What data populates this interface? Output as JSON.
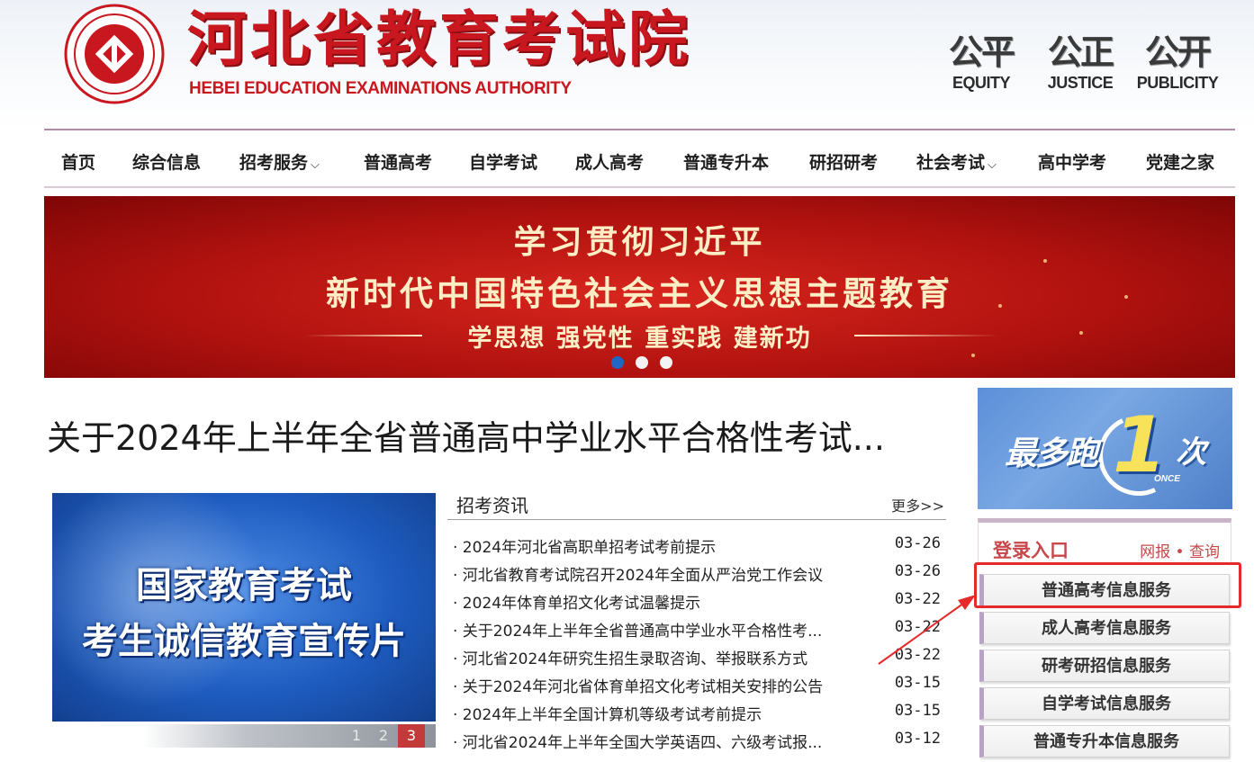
{
  "header": {
    "logo_cn": "河北省教育考试院",
    "logo_en": "HEBEI EDUCATION EXAMINATIONS AUTHORITY",
    "emblem_icon": "authority-emblem-icon",
    "mottos": [
      {
        "cn": "公平",
        "en": "EQUITY"
      },
      {
        "cn": "公正",
        "en": "JUSTICE"
      },
      {
        "cn": "公开",
        "en": "PUBLICITY"
      }
    ]
  },
  "nav": {
    "items": [
      {
        "label": "首页",
        "dropdown": false
      },
      {
        "label": "综合信息",
        "dropdown": false
      },
      {
        "label": "招考服务",
        "dropdown": true
      },
      {
        "label": "普通高考",
        "dropdown": false
      },
      {
        "label": "自学考试",
        "dropdown": false
      },
      {
        "label": "成人高考",
        "dropdown": false
      },
      {
        "label": "普通专升本",
        "dropdown": false
      },
      {
        "label": "研招研考",
        "dropdown": false
      },
      {
        "label": "社会考试",
        "dropdown": true
      },
      {
        "label": "高中学考",
        "dropdown": false
      },
      {
        "label": "党建之家",
        "dropdown": false
      }
    ],
    "chevron": "⌵"
  },
  "banner": {
    "line1": "学习贯彻习近平",
    "line2": "新时代中国特色社会主义思想主题教育",
    "line3": "学思想 强党性 重实践 建新功",
    "slide_count": 3,
    "active_slide": 0
  },
  "headline": "关于2024年上半年全省普通高中学业水平合格性考试...",
  "video": {
    "line1": "国家教育考试",
    "line2": "考生诚信教育宣传片",
    "pages": [
      "1",
      "2",
      "3"
    ],
    "active_page": 2
  },
  "news": {
    "title": "招考资讯",
    "more": "更多>>",
    "items": [
      {
        "title": "· 2024年河北省高职单招考试考前提示",
        "date": "03-26"
      },
      {
        "title": "· 河北省教育考试院召开2024年全面从严治党工作会议",
        "date": "03-26"
      },
      {
        "title": "· 2024年体育单招文化考试温馨提示",
        "date": "03-22"
      },
      {
        "title": "· 关于2024年上半年全省普通高中学业水平合格性考...",
        "date": "03-22"
      },
      {
        "title": "· 河北省2024年研究生招生录取咨询、举报联系方式",
        "date": "03-22"
      },
      {
        "title": "· 关于2024年河北省体育单招文化考试相关安排的公告",
        "date": "03-15"
      },
      {
        "title": "· 2024年上半年全国计算机等级考试考前提示",
        "date": "03-15"
      },
      {
        "title": "· 河北省2024年上半年全国大学英语四、六级考试报...",
        "date": "03-12"
      }
    ]
  },
  "sidebar": {
    "promo": {
      "text": "最多跑",
      "one": "1",
      "ci": "次",
      "once": "ONCE"
    },
    "login": {
      "title": "登录入口",
      "sub": "网报 • 查询"
    },
    "services": [
      "普通高考信息服务",
      "成人高考信息服务",
      "研考研招信息服务",
      "自学考试信息服务",
      "普通专升本信息服务"
    ]
  },
  "colors": {
    "brand_red": "#c8171e",
    "nav_border": "#b08aa8",
    "highlight": "#e62a2a",
    "slide_active": "#1f66c7"
  }
}
